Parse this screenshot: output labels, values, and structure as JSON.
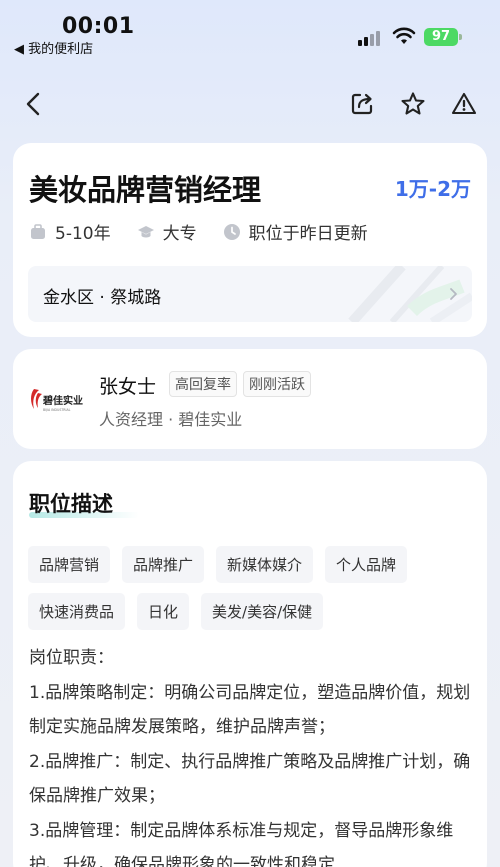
{
  "status_bar": {
    "time": "00:01",
    "back_app": "◀ 我的便利店",
    "battery": "97"
  },
  "job": {
    "title": "美妆品牌营销经理",
    "salary": "1万-2万",
    "experience": "5-10年",
    "education": "大专",
    "updated": "职位于昨日更新",
    "location": "金水区 · 祭城路"
  },
  "hr": {
    "name": "张女士",
    "badges": [
      "高回复率",
      "刚刚活跃"
    ],
    "role": "人资经理 · 碧佳实业",
    "logo_text": "碧佳实业",
    "logo_sub": "BIJIA INDUSTRIAL"
  },
  "description": {
    "title": "职位描述",
    "tags": [
      "品牌营销",
      "品牌推广",
      "新媒体媒介",
      "个人品牌",
      "快速消费品",
      "日化",
      "美发/美容/保健"
    ],
    "lines": [
      "岗位职责：",
      "1.品牌策略制定：明确公司品牌定位，塑造品牌价值，规划制定实施品牌发展策略，维护品牌声誉；",
      "2.品牌推广：制定、执行品牌推广策略及品牌推广计划，确保品牌推广效果；",
      "3.品牌管理：制定品牌体系标准与规定，督导品牌形象维护、升级，确保品牌形象的一致性和稳定"
    ]
  },
  "icons": {
    "back": "chevron-left-icon",
    "share": "share-icon",
    "favorite": "star-icon",
    "report": "warning-icon"
  },
  "colors": {
    "salary": "#3f6ee8",
    "battery": "#4cd964"
  }
}
